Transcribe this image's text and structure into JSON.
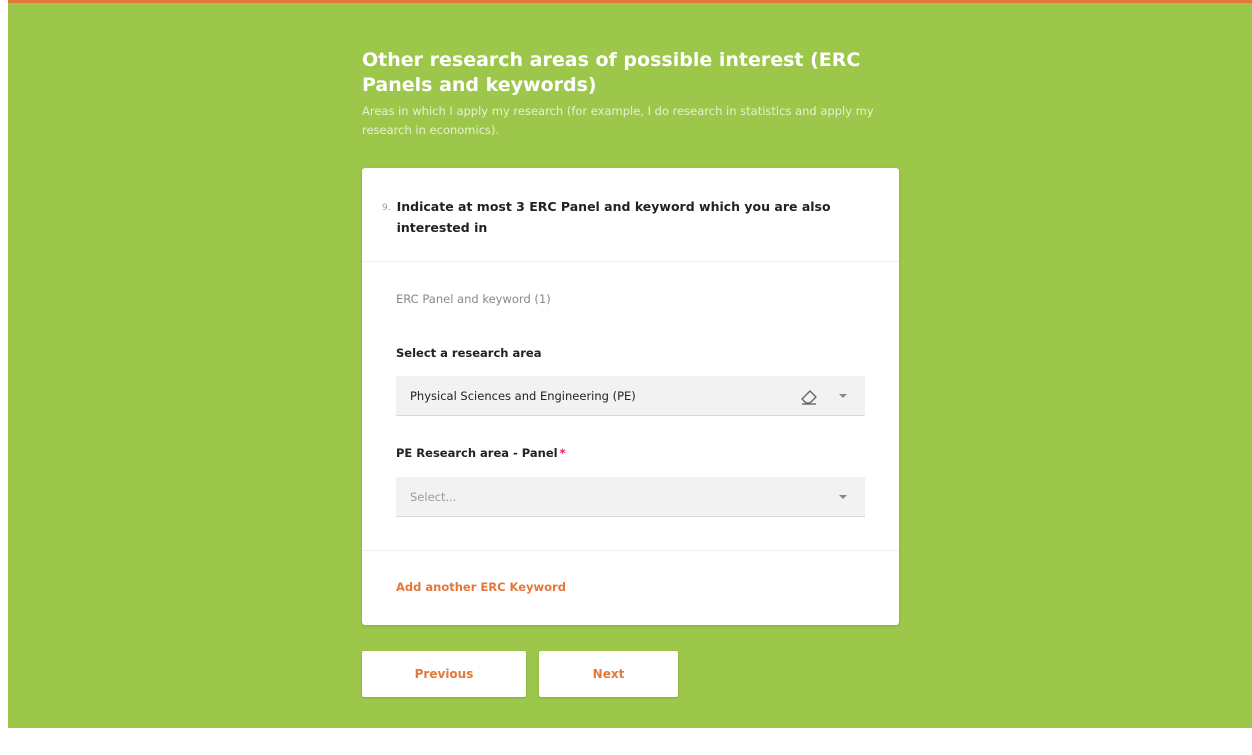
{
  "section": {
    "title": "Other research areas of possible interest (ERC Panels and keywords)",
    "description": "Areas in which I apply my research (for example, I do research in statistics and apply my research in economics)."
  },
  "question": {
    "number": "9.",
    "text": "Indicate at most 3 ERC Panel and keyword which you are also interested in"
  },
  "group": {
    "label": "ERC Panel and keyword (1)"
  },
  "research_area": {
    "label": "Select a research area",
    "value": "Physical Sciences and Engineering (PE)"
  },
  "panel": {
    "label": "PE Research area - Panel",
    "required_mark": "*",
    "placeholder": "Select..."
  },
  "add_keyword": "Add another ERC Keyword",
  "nav": {
    "previous": "Previous",
    "next": "Next"
  },
  "colors": {
    "background": "#9cc74b",
    "accent": "#e3783a",
    "required": "#e0245e"
  },
  "icons": [
    "eraser-icon",
    "caret-down-icon"
  ]
}
